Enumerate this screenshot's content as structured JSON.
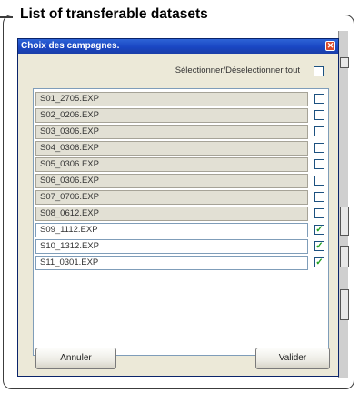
{
  "frame": {
    "title": "List of transferable datasets"
  },
  "dialog": {
    "title": "Choix des campagnes.",
    "close_glyph": "✕",
    "select_all_label": "Sélectionner/Déselectionner tout",
    "select_all_checked": false,
    "items": [
      {
        "label": "S01_2705.EXP",
        "checked": false
      },
      {
        "label": "S02_0206.EXP",
        "checked": false
      },
      {
        "label": "S03_0306.EXP",
        "checked": false
      },
      {
        "label": "S04_0306.EXP",
        "checked": false
      },
      {
        "label": "S05_0306.EXP",
        "checked": false
      },
      {
        "label": "S06_0306.EXP",
        "checked": false
      },
      {
        "label": "S07_0706.EXP",
        "checked": false
      },
      {
        "label": "S08_0612.EXP",
        "checked": false
      },
      {
        "label": "S09_1112.EXP",
        "checked": true
      },
      {
        "label": "S10_1312.EXP",
        "checked": true
      },
      {
        "label": "S11_0301.EXP",
        "checked": true
      }
    ],
    "cancel_label": "Annuler",
    "ok_label": "Valider",
    "check_color": "#21a121",
    "accent_color": "#1946c3"
  }
}
